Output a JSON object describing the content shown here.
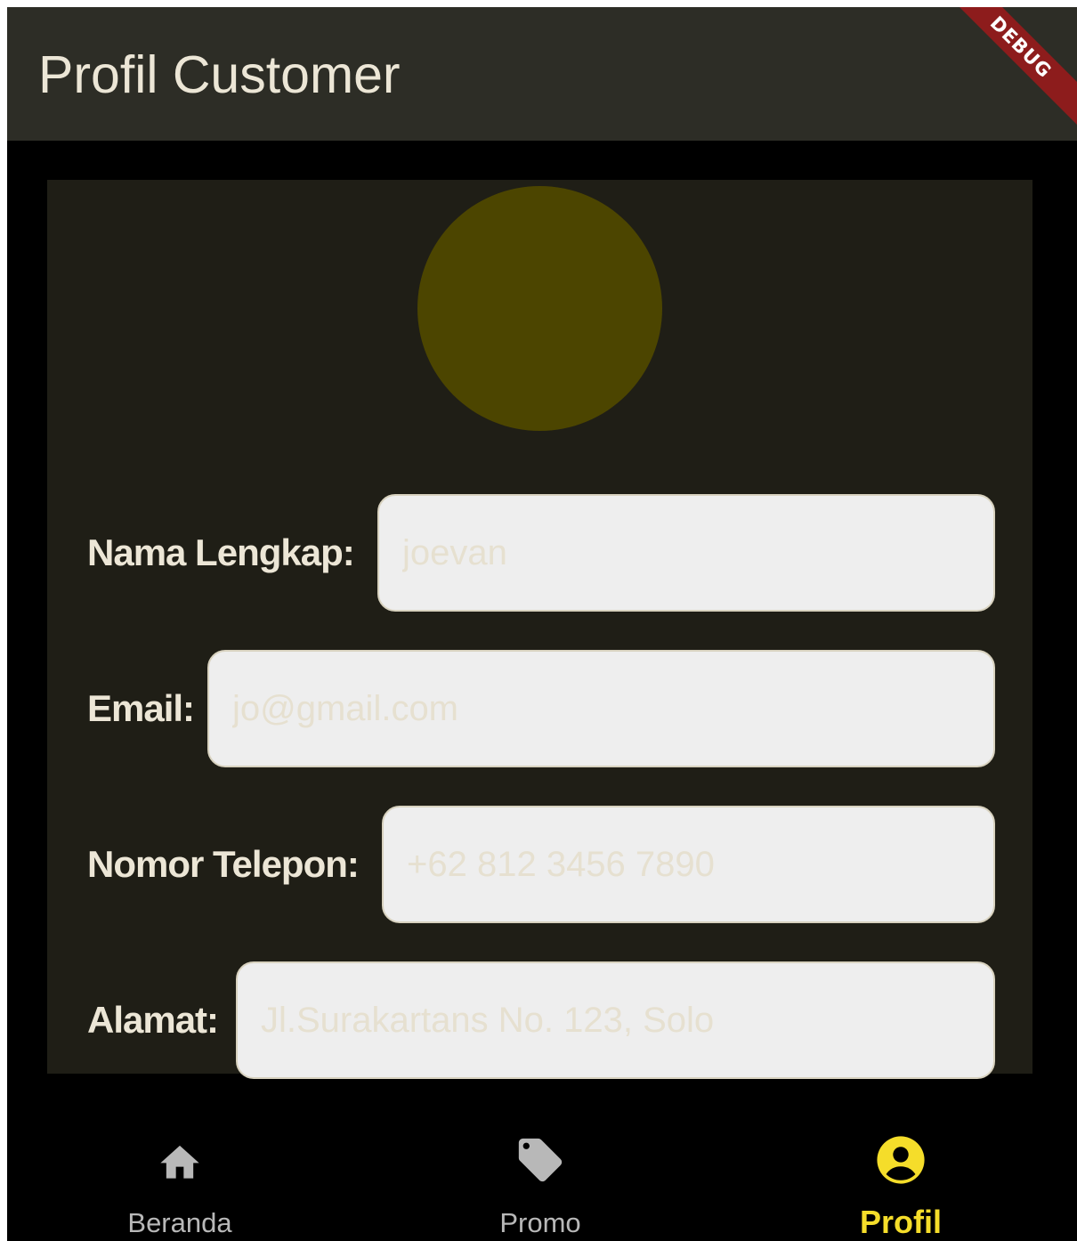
{
  "app_bar": {
    "title": "Profil Customer",
    "debug_banner": "DEBUG"
  },
  "profile": {
    "avatar_color": "#4c4500",
    "fields": [
      {
        "label": "Nama Lengkap:",
        "placeholder": "joevan"
      },
      {
        "label": "Email:",
        "placeholder": "jo@gmail.com"
      },
      {
        "label": "Nomor Telepon:",
        "placeholder": "+62 812 3456 7890"
      },
      {
        "label": "Alamat:",
        "placeholder": "Jl.Surakartans No. 123, Solo"
      }
    ]
  },
  "bottom_nav": {
    "items": [
      {
        "label": "Beranda",
        "icon": "home-icon",
        "active": false
      },
      {
        "label": "Promo",
        "icon": "tag-icon",
        "active": false
      },
      {
        "label": "Profil",
        "icon": "account-circle-icon",
        "active": true
      }
    ],
    "active_color": "#f5dd2a",
    "inactive_color": "#b8b8b8"
  }
}
